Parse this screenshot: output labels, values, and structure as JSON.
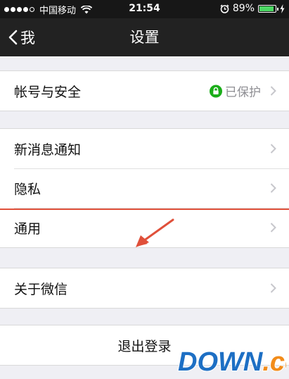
{
  "status_bar": {
    "carrier": "中国移动",
    "time": "21:54",
    "battery_percent": "89%",
    "battery_level": 0.89,
    "icons": [
      "signal-dots-icon",
      "wifi-icon",
      "alarm-icon",
      "battery-icon",
      "charging-icon"
    ]
  },
  "nav": {
    "back_label": "我",
    "title": "设置"
  },
  "sections": {
    "account": {
      "label": "帐号与安全",
      "status": "已保护",
      "status_icon": "lock-icon",
      "status_color": "#1aad19"
    },
    "notifications": {
      "label": "新消息通知"
    },
    "privacy": {
      "label": "隐私"
    },
    "general": {
      "label": "通用"
    },
    "about": {
      "label": "关于微信"
    },
    "logout": {
      "label": "退出登录"
    }
  },
  "annotation": {
    "color": "#e0503a"
  },
  "watermark": {
    "text": "DOWN.cc",
    "primary": "DOWN",
    "secondary": ".cc"
  },
  "colors": {
    "nav_background": "#222222",
    "page_background": "#efeff4",
    "accent_green": "#1aad19"
  }
}
